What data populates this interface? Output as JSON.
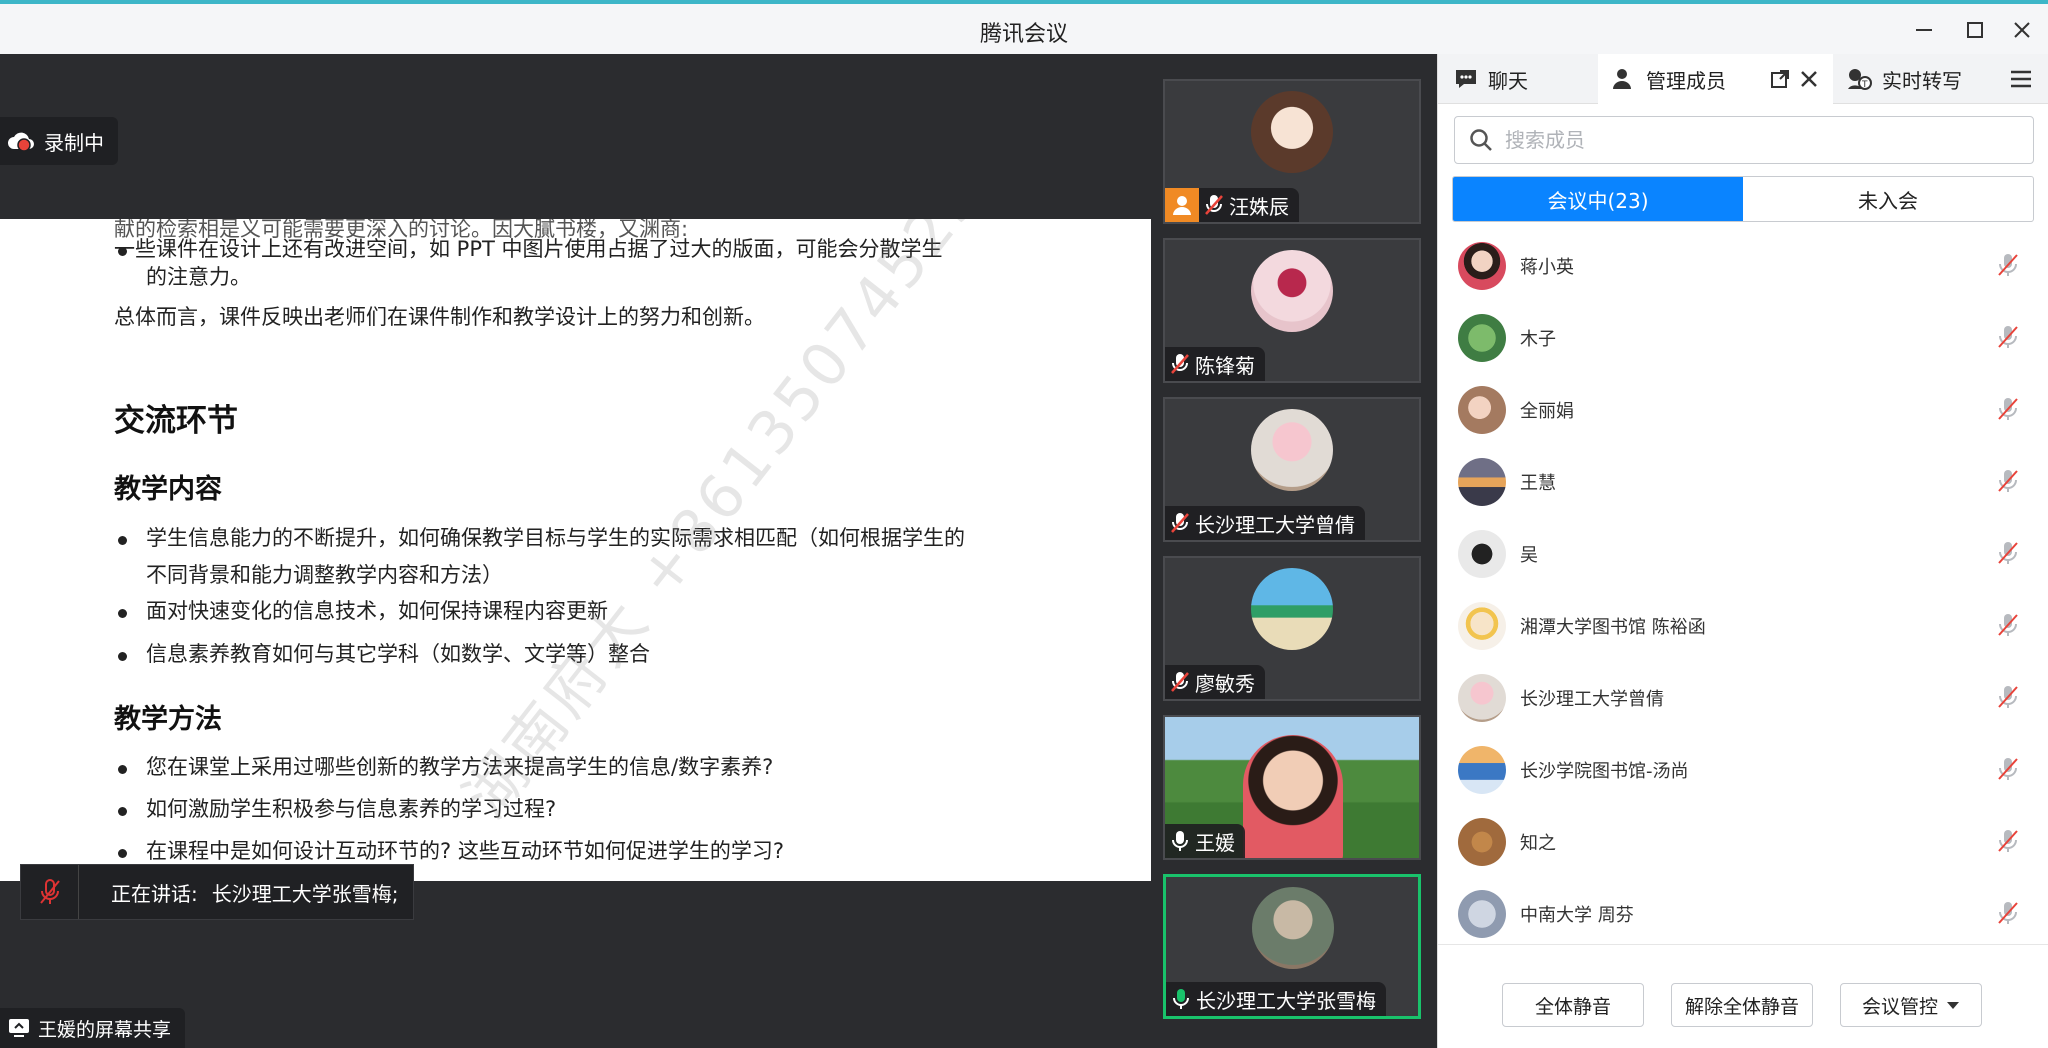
{
  "window": {
    "title": "腾讯会议",
    "minimize_icon": "minimize-icon",
    "maximize_icon": "maximize-icon",
    "close_icon": "close-icon"
  },
  "share": {
    "recording_label": "录制中",
    "share_label": "王媛的屏幕共享",
    "speaking_prefix": "正在讲话:",
    "speaking_name": "长沙理工大学张雪梅;",
    "watermark": "湖南府大 +8613507452511"
  },
  "document": {
    "partial_line": "献的检索相是义可能需要更深入的讨论。因大膩书楼，又渊商:",
    "bullet1_line1": "一些课件在设计上还有改进空间，如 PPT 中图片使用占据了过大的版面，可能会分散学生",
    "bullet1_line2": "的注意力。",
    "summary": "总体而言，课件反映出老师们在课件制作和教学设计上的努力和创新。",
    "section_title": "交流环节",
    "sub1_title": "教学内容",
    "sub1_b1_line1": "学生信息能力的不断提升，如何确保教学目标与学生的实际需求相匹配（如何根据学生的",
    "sub1_b1_line2": "不同背景和能力调整教学内容和方法）",
    "sub1_b2": "面对快速变化的信息技术，如何保持课程内容更新",
    "sub1_b3": "信息素养教育如何与其它学科（如数学、文学等）整合",
    "sub2_title": "教学方法",
    "sub2_b1": "您在课堂上采用过哪些创新的教学方法来提高学生的信息/数字素养?",
    "sub2_b2": "如何激励学生积极参与信息素养的学习过程?",
    "sub2_b3": "在课程中是如何设计互动环节的? 这些互动环节如何促进学生的学习?"
  },
  "videos": [
    {
      "name": "汪姝辰",
      "host": true,
      "muted": true
    },
    {
      "name": "陈锋菊",
      "host": false,
      "muted": true
    },
    {
      "name": "长沙理工大学曾倩",
      "host": false,
      "muted": true
    },
    {
      "name": "廖敏秀",
      "host": false,
      "muted": true
    },
    {
      "name": "王媛",
      "host": false,
      "muted": false
    },
    {
      "name": "长沙理工大学张雪梅",
      "host": false,
      "muted": false,
      "active": true
    }
  ],
  "panel": {
    "tabs": {
      "chat": "聊天",
      "members": "管理成员",
      "transcribe": "实时转写"
    },
    "search_placeholder": "搜索成员",
    "seg_in_meeting": "会议中(23)",
    "seg_not_joined": "未入会",
    "members": [
      {
        "name": "蒋小英"
      },
      {
        "name": "木子"
      },
      {
        "name": "全丽娟"
      },
      {
        "name": "王慧"
      },
      {
        "name": "吴"
      },
      {
        "name": "湘潭大学图书馆 陈裕函"
      },
      {
        "name": "长沙理工大学曾倩"
      },
      {
        "name": "长沙学院图书馆-汤尚"
      },
      {
        "name": "知之"
      },
      {
        "name": "中南大学 周芬"
      }
    ],
    "footer": {
      "mute_all": "全体静音",
      "unmute_all": "解除全体静音",
      "control": "会议管控"
    }
  },
  "colors": {
    "accent": "#0a84ff",
    "active_speaker": "#19c26b",
    "host_badge": "#f08a24",
    "recording": "#e8433a"
  }
}
